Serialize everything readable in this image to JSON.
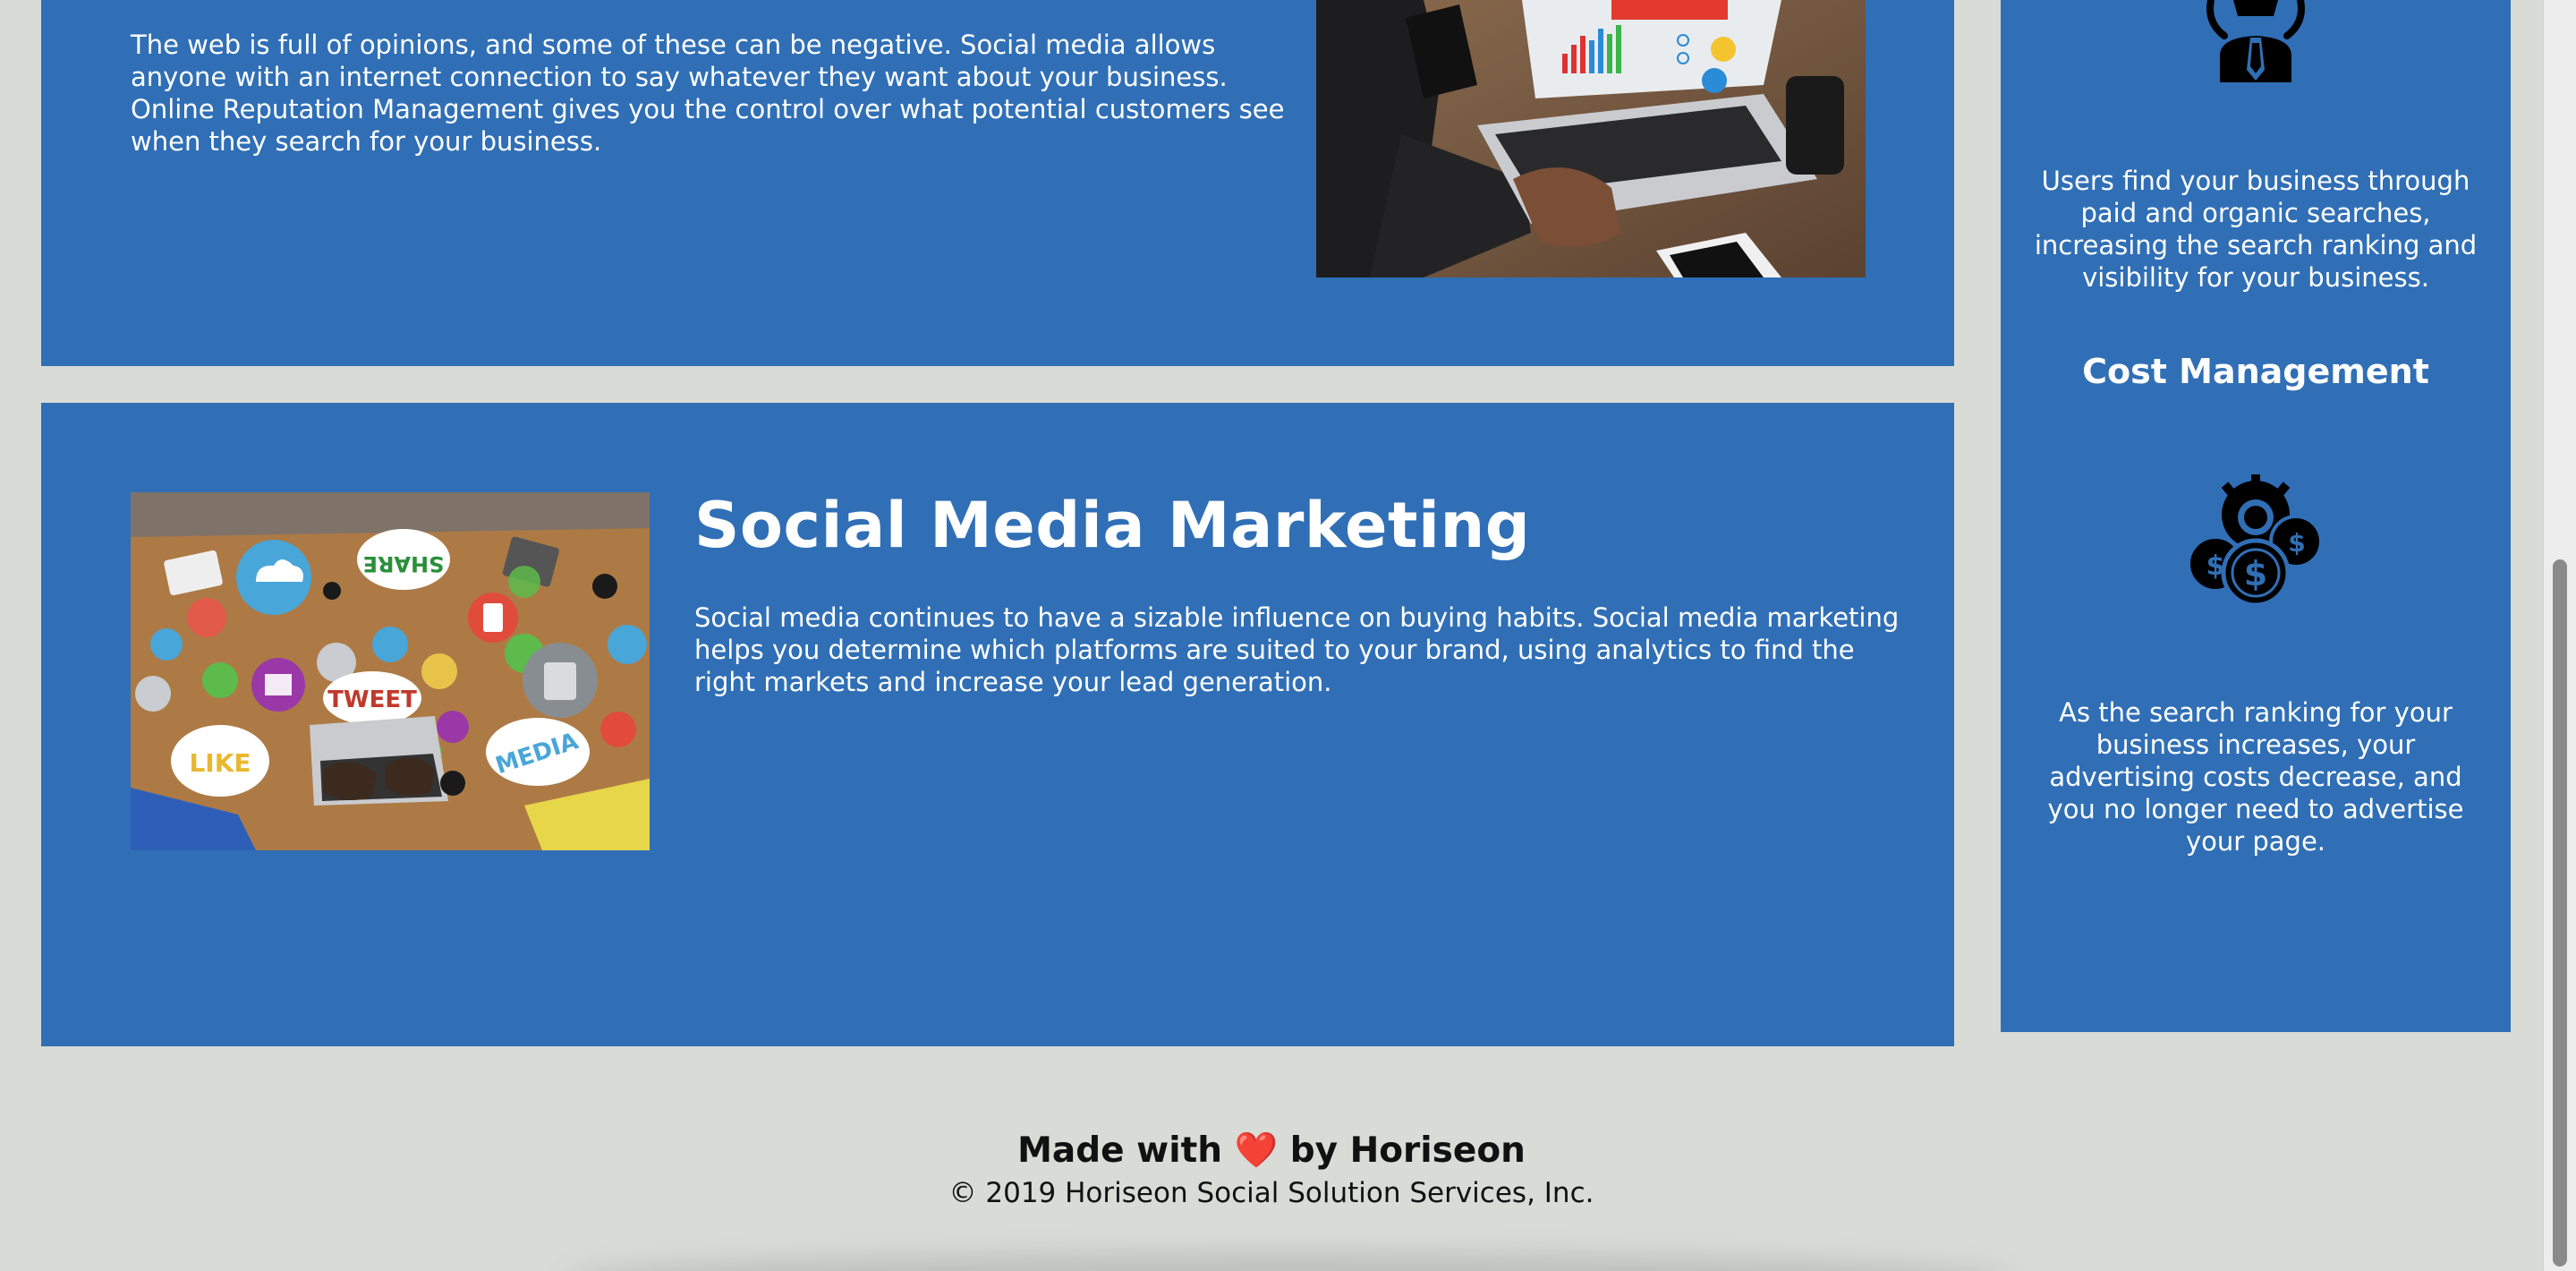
{
  "orm_section": {
    "text": "The web is full of opinions, and some of these can be negative. Social media allows anyone with an internet connection to say whatever they want about your business. Online Reputation Management gives you the control over what potential customers see when they search for your business.",
    "photo_icon": "laptop-analytics-photo"
  },
  "smm_section": {
    "title": "Social Media Marketing",
    "text": "Social media continues to have a sizable influence on buying habits. Social media marketing helps you determine which platforms are suited to your brand, using analytics to find the right markets and increase your lead generation.",
    "photo_icon": "social-media-collage-photo",
    "collage_labels": {
      "share": "SHARE",
      "tweet": "TWEET",
      "like": "LIKE",
      "media": "MEDIA"
    }
  },
  "sidebar": {
    "top_icon": "lightbulb-person-icon",
    "lead_text": "Users find your business through paid and organic searches, increasing the search ranking and visibility for your business.",
    "cost_heading": "Cost Management",
    "cost_icon": "money-gear-icon",
    "cost_text": "As the search ranking for your business increases, your advertising costs decrease, and you no longer need to advertise your page."
  },
  "footer": {
    "made_prefix": "Made with",
    "heart": "❤️",
    "made_suffix": "by Horiseon",
    "copyright": "© 2019 Horiseon Social Solution Services, Inc."
  },
  "colors": {
    "card_blue": "#306fb6",
    "page_bg": "#d9dbd6",
    "heart_red": "#e0202a"
  }
}
